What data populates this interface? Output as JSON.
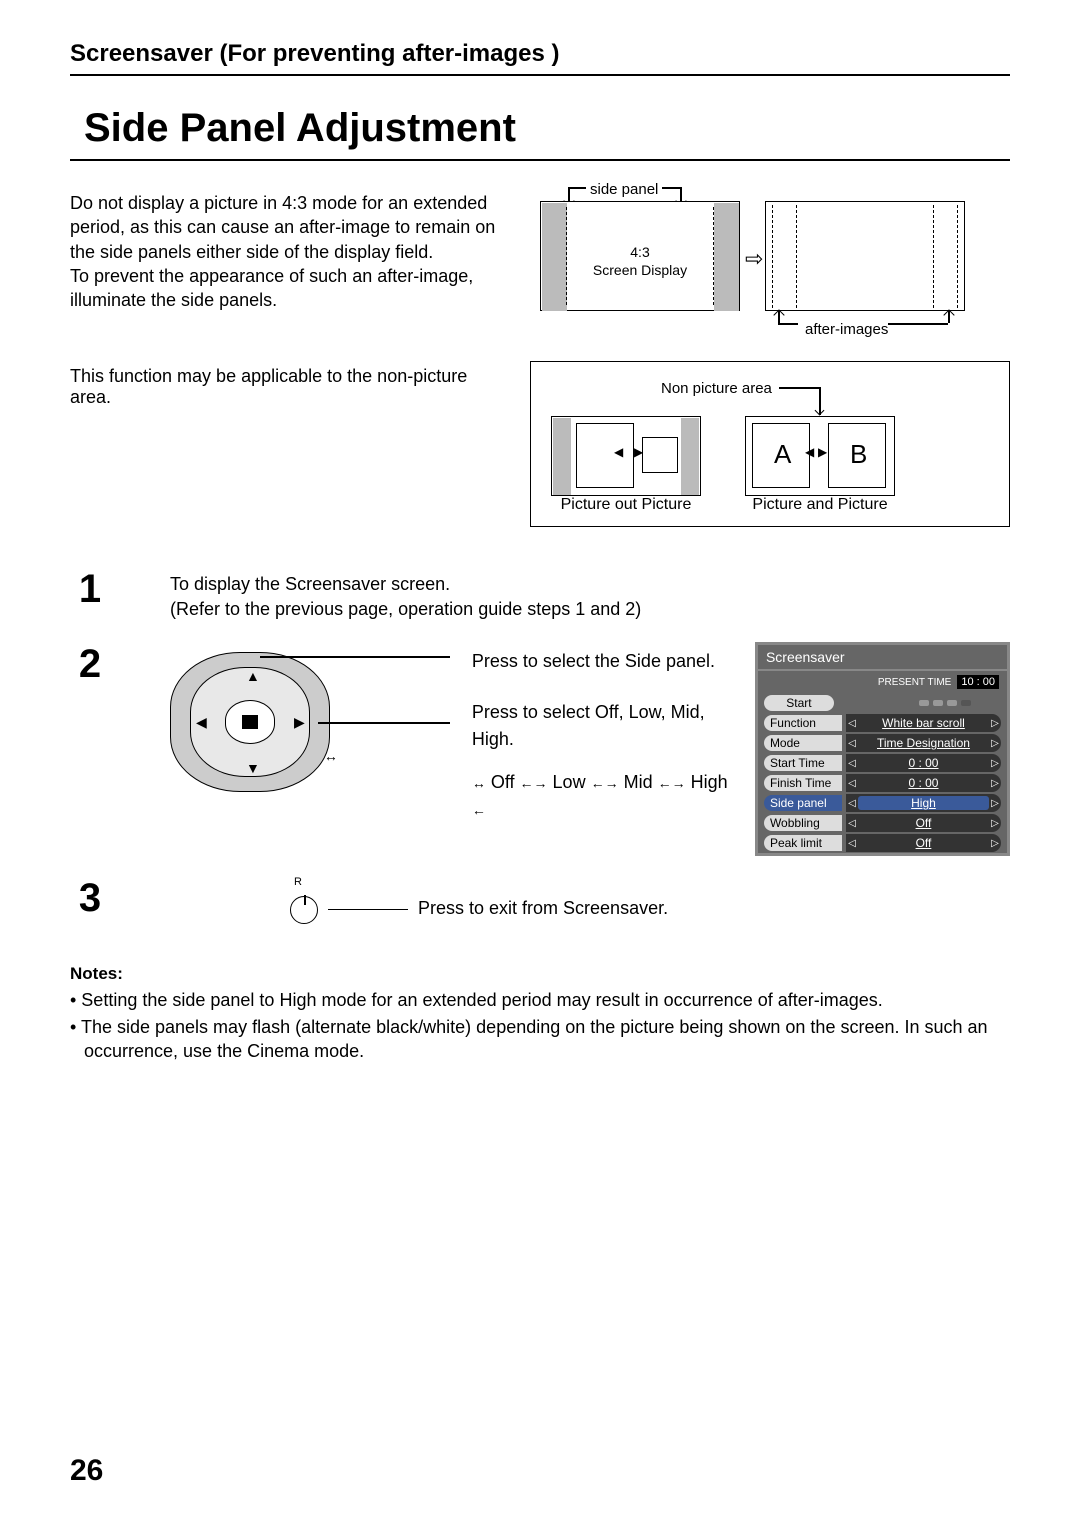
{
  "section_header": "Screensaver (For preventing after-images )",
  "main_title": "Side Panel Adjustment",
  "intro_text": "Do not display a picture in 4:3 mode for an extended period, as this can cause an after-image to remain on the side panels either side of the display field.\nTo prevent the appearance of such an after-image, illuminate the side panels.",
  "diag1": {
    "side_panel": "side panel",
    "ratio": "4:3",
    "screen_display": "Screen Display",
    "after_images": "after-images"
  },
  "row2_text": "This function may be applicable to the non-picture area.",
  "diag2": {
    "non_picture": "Non picture area",
    "A": "A",
    "B": "B",
    "cap1": "Picture out Picture",
    "cap2": "Picture and Picture"
  },
  "steps": {
    "s1_num": "1",
    "s1_l1": "To display the Screensaver screen.",
    "s1_l2": "(Refer to the previous page, operation guide steps 1 and 2)",
    "s2_num": "2",
    "s2_instr1": "Press to select the Side panel.",
    "s2_instr2": "Press to select Off, Low, Mid, High.",
    "s2_cycle": "Off ←→ Low ←→ Mid ←→ High",
    "s3_num": "3",
    "s3_r": "R",
    "s3_text": "Press to exit from Screensaver."
  },
  "osd": {
    "title": "Screensaver",
    "present_time_label": "PRESENT TIME",
    "present_time": "10 : 00",
    "start": "Start",
    "rows": [
      {
        "label": "Function",
        "value": "White bar scroll"
      },
      {
        "label": "Mode",
        "value": "Time Designation"
      },
      {
        "label": "Start Time",
        "value": "0 : 00"
      },
      {
        "label": "Finish Time",
        "value": "0 : 00"
      },
      {
        "label": "Side  panel",
        "value": "High",
        "hl": true
      },
      {
        "label": "Wobbling",
        "value": "Off"
      },
      {
        "label": "Peak limit",
        "value": "Off"
      }
    ]
  },
  "notes": {
    "heading": "Notes:",
    "n1": "• Setting the side panel to High mode for an extended period may result in occurrence of after-images.",
    "n2": "• The side panels may flash (alternate black/white) depending on the picture being shown on the screen. In such an occurrence, use the Cinema mode."
  },
  "page_number": "26"
}
